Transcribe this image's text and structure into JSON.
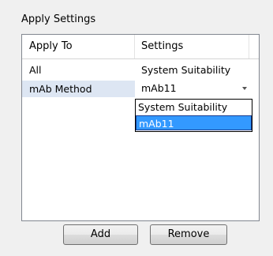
{
  "group_title": "Apply Settings",
  "columns": [
    "Apply To",
    "Settings"
  ],
  "rows": [
    {
      "apply_to": "All",
      "settings": "System Suitability"
    },
    {
      "apply_to": "mAb Method",
      "settings": "mAb11"
    }
  ],
  "dropdown": {
    "options": [
      "System Suitability",
      "mAb11"
    ],
    "selected": "mAb11"
  },
  "buttons": {
    "add": "Add",
    "remove": "Remove"
  },
  "colors": {
    "highlight": "#3399ff",
    "row_selected": "#dde6f3"
  }
}
